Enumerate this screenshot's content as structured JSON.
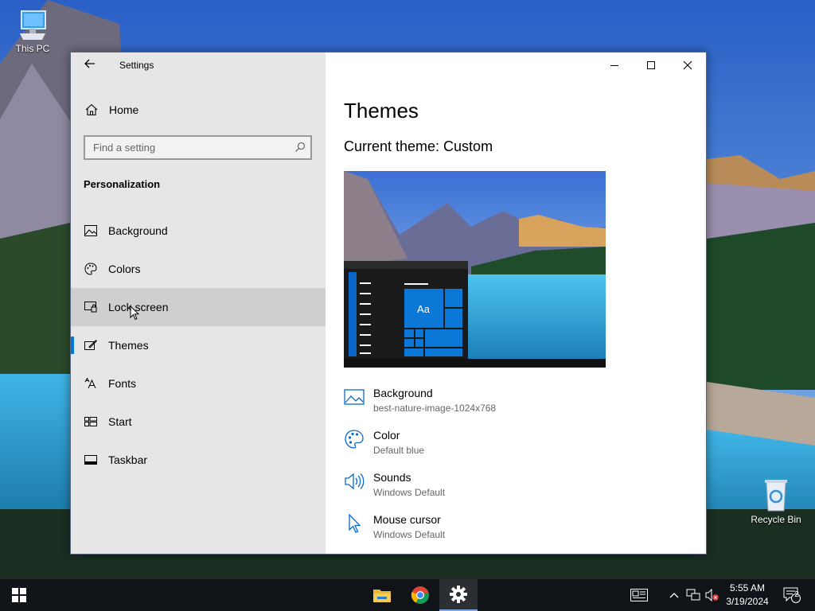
{
  "desktop": {
    "icons": [
      {
        "label": "This PC"
      },
      {
        "label": "Recycle Bin"
      }
    ]
  },
  "window": {
    "app_title": "Settings",
    "sidebar": {
      "home_label": "Home",
      "search_placeholder": "Find a setting",
      "section_heading": "Personalization",
      "items": [
        {
          "label": "Background",
          "icon": "picture-icon"
        },
        {
          "label": "Colors",
          "icon": "palette-icon"
        },
        {
          "label": "Lock screen",
          "icon": "lock-screen-icon",
          "state": "hover"
        },
        {
          "label": "Themes",
          "icon": "themes-icon",
          "state": "selected"
        },
        {
          "label": "Fonts",
          "icon": "fonts-icon"
        },
        {
          "label": "Start",
          "icon": "start-icon"
        },
        {
          "label": "Taskbar",
          "icon": "taskbar-icon"
        }
      ]
    },
    "main": {
      "title": "Themes",
      "current_theme": "Current theme: Custom",
      "preview_tile_label": "Aa",
      "properties": [
        {
          "title": "Background",
          "value": "best-nature-image-1024x768",
          "icon": "picture-icon"
        },
        {
          "title": "Color",
          "value": "Default blue",
          "icon": "palette-icon"
        },
        {
          "title": "Sounds",
          "value": "Windows Default",
          "icon": "speaker-icon"
        },
        {
          "title": "Mouse cursor",
          "value": "Windows Default",
          "icon": "cursor-icon"
        }
      ]
    }
  },
  "taskbar": {
    "clock_time": "5:55 AM",
    "clock_date": "3/19/2024",
    "notification_count": "2"
  },
  "colors": {
    "accent": "#0078d7",
    "sidebar_bg": "#e6e6e6",
    "taskbar_bg": "#101418"
  }
}
